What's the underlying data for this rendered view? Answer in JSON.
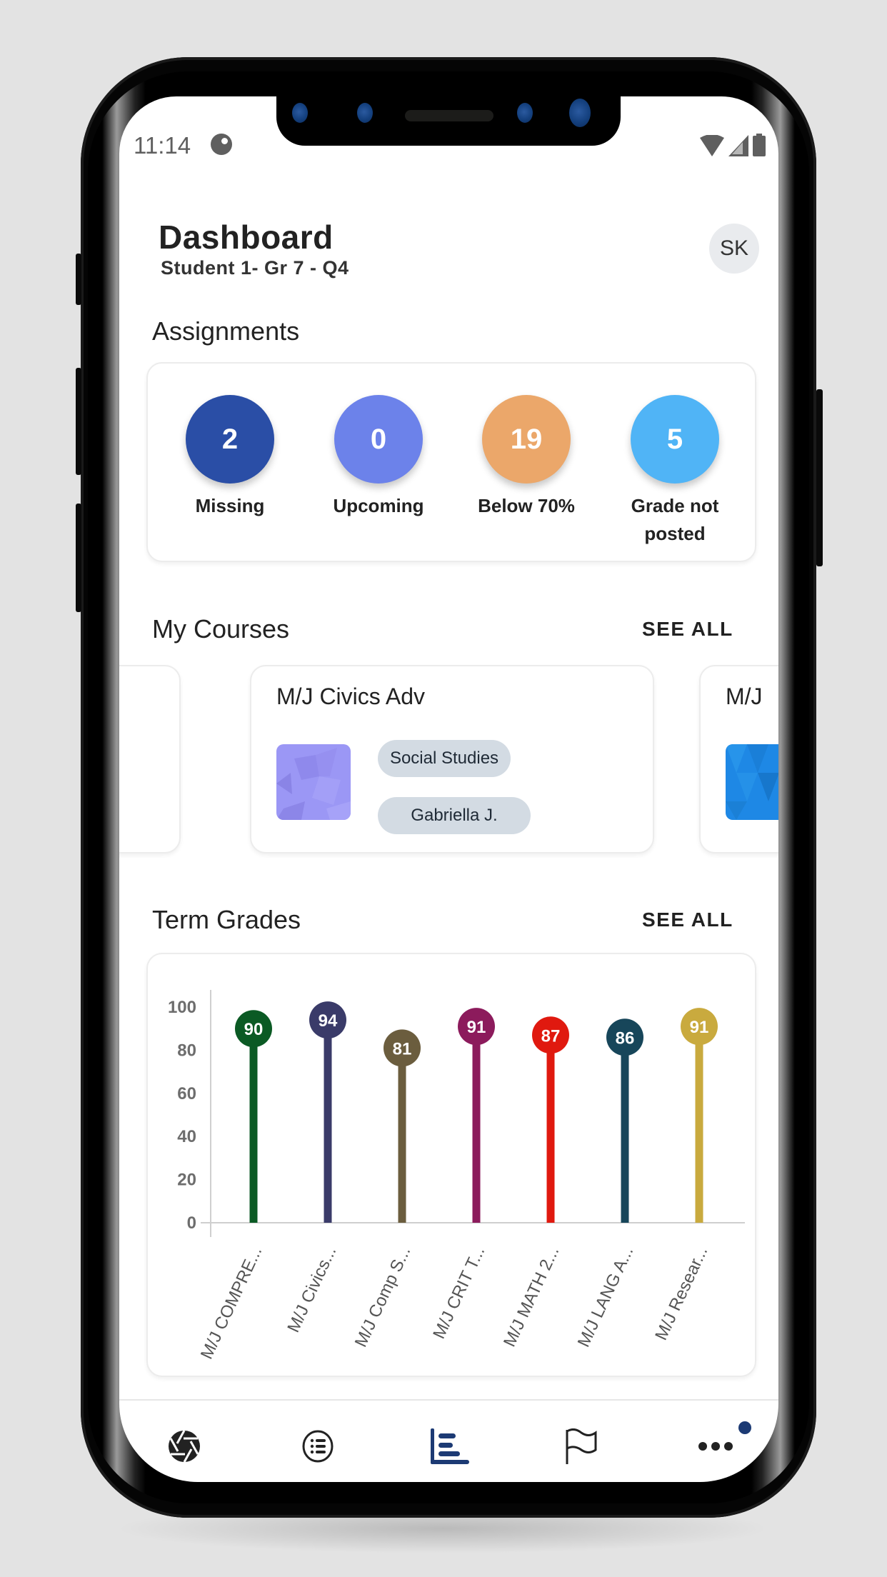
{
  "status_bar": {
    "time": "11:14",
    "icons": [
      "app-notification-icon",
      "wifi-icon",
      "signal-icon",
      "battery-icon"
    ]
  },
  "header": {
    "title": "Dashboard",
    "subtitle": "Student 1- Gr 7 - Q4",
    "avatar_initials": "SK"
  },
  "assignments": {
    "title": "Assignments",
    "items": [
      {
        "count": "2",
        "label": "Missing",
        "color": "#2a4ea6"
      },
      {
        "count": "0",
        "label": "Upcoming",
        "color": "#6c82ea"
      },
      {
        "count": "19",
        "label": "Below 70%",
        "color": "#eba76a"
      },
      {
        "count": "5",
        "label": "Grade not posted",
        "color": "#50b4f6"
      }
    ]
  },
  "courses": {
    "title": "My Courses",
    "see_all": "SEE ALL",
    "items": [
      {
        "name": "",
        "chips": [],
        "thumb_color": ""
      },
      {
        "name": "M/J Civics Adv",
        "chips": [
          "Social Studies",
          "Gabriella J."
        ],
        "thumb_color": "#9b97f5"
      },
      {
        "name": "M/J",
        "chips": [],
        "thumb_color": "#1e88e5"
      }
    ]
  },
  "term_grades": {
    "title": "Term Grades",
    "see_all": "SEE ALL"
  },
  "chart_data": {
    "type": "bar",
    "style": "lollipop",
    "title": "Term Grades",
    "xlabel": "",
    "ylabel": "",
    "ylim": [
      0,
      100
    ],
    "yticks": [
      0,
      20,
      40,
      60,
      80,
      100
    ],
    "grid": false,
    "categories": [
      "M/J COMPRE...",
      "M/J Civics...",
      "M/J Comp S...",
      "M/J CRIT T...",
      "M/J MATH 2...",
      "M/J LANG A...",
      "M/J Resear..."
    ],
    "values": [
      90,
      94,
      81,
      91,
      87,
      86,
      91
    ],
    "colors": [
      "#0b5a24",
      "#3a3b69",
      "#6b5d3e",
      "#8c1b5c",
      "#e0190f",
      "#17465a",
      "#c9aa3e"
    ]
  },
  "bottom_nav": {
    "items": [
      {
        "icon": "aperture-icon",
        "active": false
      },
      {
        "icon": "list-icon",
        "active": false
      },
      {
        "icon": "bar-chart-icon",
        "active": true
      },
      {
        "icon": "flag-icon",
        "active": false
      },
      {
        "icon": "more-icon",
        "active": false,
        "badge": true
      }
    ],
    "active_color": "#1c3a74"
  }
}
